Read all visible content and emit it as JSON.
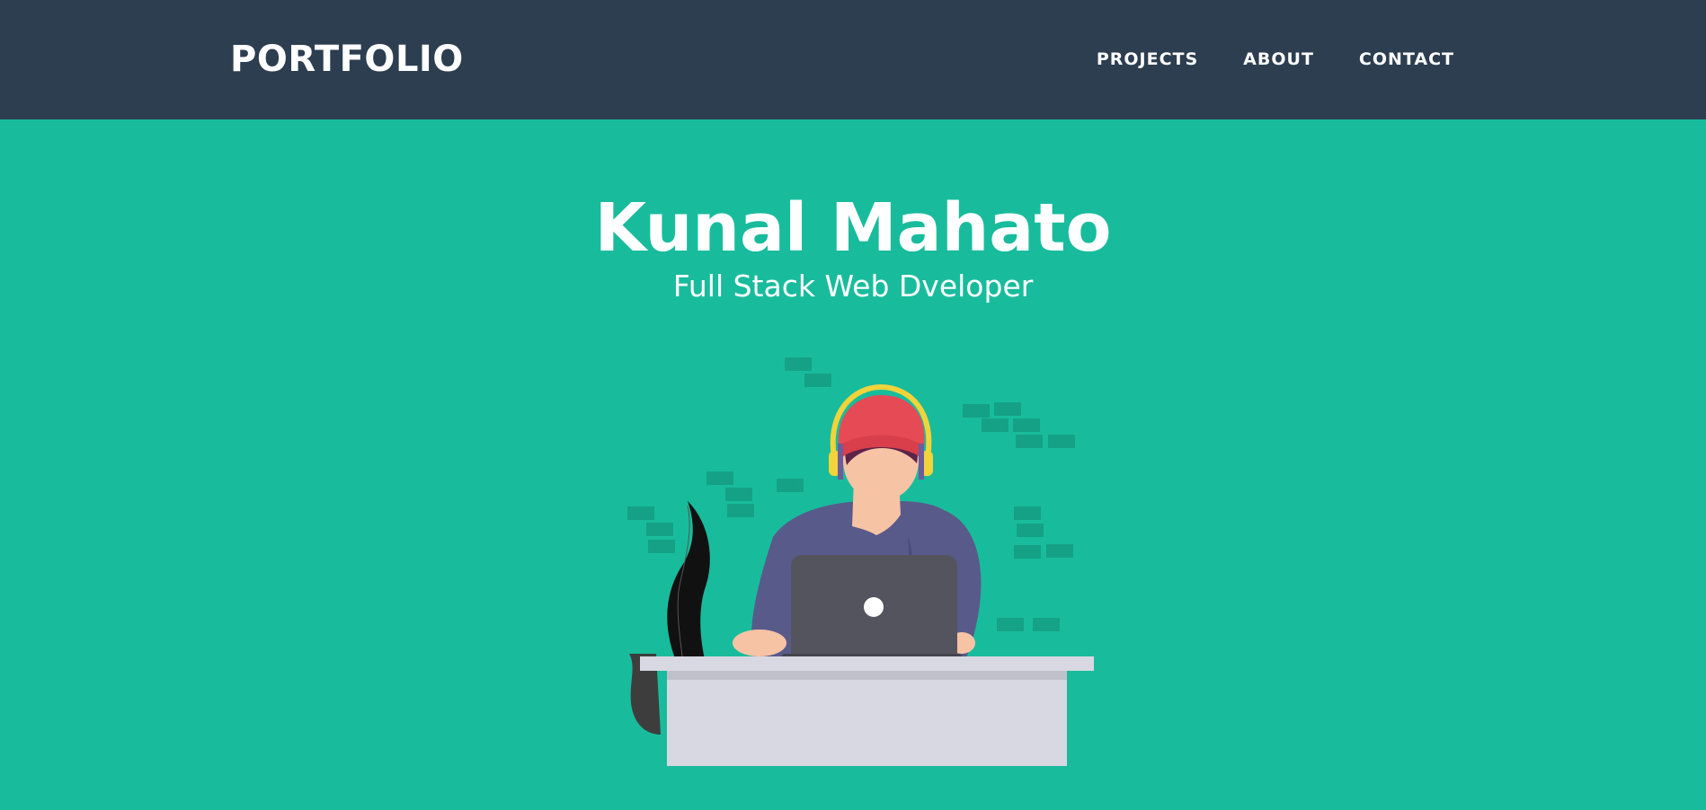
{
  "navbar": {
    "brand": "PORTFOLIO",
    "links": [
      {
        "label": "PROJECTS"
      },
      {
        "label": "ABOUT"
      },
      {
        "label": "CONTACT"
      }
    ]
  },
  "hero": {
    "name": "Kunal Mahato",
    "role": "Full Stack Web Dveloper"
  },
  "colors": {
    "navbar_bg": "#2c3e50",
    "hero_bg": "#18bc9c",
    "text": "#ffffff"
  },
  "illustration": {
    "icon": "developer-at-laptop-illustration"
  }
}
